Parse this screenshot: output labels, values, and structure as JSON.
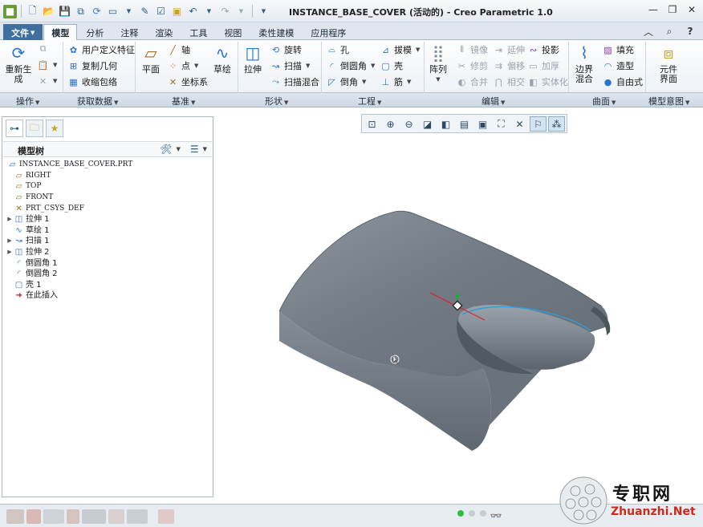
{
  "window": {
    "title": "INSTANCE_BASE_COVER (活动的) - Creo Parametric 1.0"
  },
  "ribbon_tabs": [
    "文件",
    "模型",
    "分析",
    "注释",
    "渲染",
    "工具",
    "视图",
    "柔性建模",
    "应用程序"
  ],
  "active_tab": "模型",
  "ribbon": {
    "operations": {
      "regenerate": "重新生成"
    },
    "get_data": {
      "udf": "用户定义特征",
      "copy_geom": "复制几何",
      "shrinkwrap": "收缩包络"
    },
    "datum": {
      "plane": "平面",
      "axis": "轴",
      "point": "点",
      "csys": "坐标系",
      "sketch": "草绘"
    },
    "shapes": {
      "extrude": "拉伸",
      "revolve": "旋转",
      "sweep": "扫描",
      "swept_blend": "扫描混合"
    },
    "engineering": {
      "hole": "孔",
      "round": "倒圆角",
      "chamfer": "倒角",
      "draft": "拔模",
      "shell": "壳",
      "rib": "筋"
    },
    "editing": {
      "pattern": "阵列",
      "mirror": "镜像",
      "trim": "修剪",
      "merge": "合并",
      "extend": "延伸",
      "offset": "偏移",
      "intersect": "相交",
      "project": "投影",
      "thicken": "加厚",
      "solidify": "实体化"
    },
    "surfaces": {
      "boundary_blend": "边界混合",
      "fill": "填充",
      "style": "造型",
      "freestyle": "自由式"
    },
    "model_intent": {
      "component_interface": "元件界面"
    }
  },
  "groups": [
    "操作",
    "获取数据",
    "基准",
    "形状",
    "工程",
    "编辑",
    "曲面",
    "模型意图"
  ],
  "model_tree": {
    "title": "模型树",
    "items": [
      {
        "label": "INSTANCE_BASE_COVER.PRT",
        "icon": "part-icon",
        "expandable": false,
        "mono": true,
        "indent": 0
      },
      {
        "label": "RIGHT",
        "icon": "datum-plane-icon",
        "expandable": false,
        "mono": true,
        "indent": 1
      },
      {
        "label": "TOP",
        "icon": "datum-plane-icon",
        "expandable": false,
        "mono": true,
        "indent": 1
      },
      {
        "label": "FRONT",
        "icon": "datum-plane-icon",
        "expandable": false,
        "mono": true,
        "indent": 1
      },
      {
        "label": "PRT_CSYS_DEF",
        "icon": "csys-icon",
        "expandable": false,
        "mono": true,
        "indent": 1
      },
      {
        "label": "拉伸 1",
        "icon": "extrude-icon",
        "expandable": true,
        "mono": false,
        "indent": 1
      },
      {
        "label": "草绘 1",
        "icon": "sketch-icon",
        "expandable": false,
        "mono": false,
        "indent": 1
      },
      {
        "label": "扫描 1",
        "icon": "sweep-icon",
        "expandable": true,
        "mono": false,
        "indent": 1
      },
      {
        "label": "拉伸 2",
        "icon": "extrude-icon",
        "expandable": true,
        "mono": false,
        "indent": 1
      },
      {
        "label": "倒圆角 1",
        "icon": "round-icon",
        "expandable": false,
        "mono": false,
        "indent": 1
      },
      {
        "label": "倒圆角 2",
        "icon": "round-icon",
        "expandable": false,
        "mono": false,
        "indent": 1
      },
      {
        "label": "壳 1",
        "icon": "shell-icon",
        "expandable": false,
        "mono": false,
        "indent": 1
      },
      {
        "label": "在此插入",
        "icon": "insert-here-icon",
        "expandable": false,
        "mono": false,
        "indent": 1
      }
    ]
  },
  "watermark": {
    "cn": "专职网",
    "en": "Zhuanzhi.Net"
  },
  "colors": {
    "accent": "#3f6f9e",
    "model_fill": "#6f7880",
    "highlight_edge": "#2f9fd8",
    "watermark_red": "#cc2a1f"
  }
}
